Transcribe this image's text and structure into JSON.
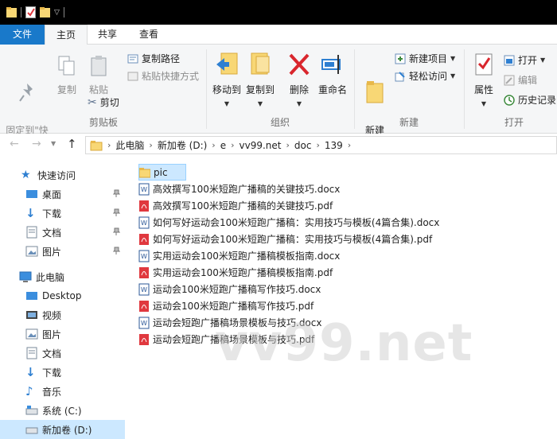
{
  "tabs": [
    {
      "label": "文件"
    },
    {
      "label": "主页"
    },
    {
      "label": "共享"
    },
    {
      "label": "查看"
    }
  ],
  "ribbon": {
    "clipboard": {
      "pin_label": "固定到\"快\n速访问\"",
      "copy_label": "复制",
      "paste_label": "粘贴",
      "copy_path_label": "复制路径",
      "paste_shortcut_label": "粘贴快捷方式",
      "cut_label": "剪切",
      "group_label": "剪贴板"
    },
    "organize": {
      "move_to_label": "移动到",
      "copy_to_label": "复制到",
      "delete_label": "删除",
      "rename_label": "重命名",
      "group_label": "组织"
    },
    "new": {
      "new_folder_label": "新建\n文件夹",
      "new_item_label": "新建项目",
      "easy_access_label": "轻松访问",
      "group_label": "新建"
    },
    "open": {
      "properties_label": "属性",
      "open_label": "打开",
      "edit_label": "编辑",
      "history_label": "历史记录",
      "group_label": "打开"
    }
  },
  "address": {
    "crumbs": [
      "此电脑",
      "新加卷 (D:)",
      "e",
      "vv99.net",
      "doc",
      "139"
    ]
  },
  "nav": {
    "quick_access": "快速访问",
    "quick_items": [
      {
        "label": "桌面"
      },
      {
        "label": "下载"
      },
      {
        "label": "文档"
      },
      {
        "label": "图片"
      }
    ],
    "this_pc": "此电脑",
    "pc_items": [
      {
        "label": "Desktop"
      },
      {
        "label": "视频"
      },
      {
        "label": "图片"
      },
      {
        "label": "文档"
      },
      {
        "label": "下载"
      },
      {
        "label": "音乐"
      },
      {
        "label": "系统 (C:)"
      },
      {
        "label": "新加卷 (D:)"
      }
    ]
  },
  "files": [
    {
      "name": "pic",
      "type": "folder"
    },
    {
      "name": "高效撰写100米短跑广播稿的关键技巧.docx",
      "type": "docx"
    },
    {
      "name": "高效撰写100米短跑广播稿的关键技巧.pdf",
      "type": "pdf"
    },
    {
      "name": "如何写好运动会100米短跑广播稿：实用技巧与模板(4篇合集).docx",
      "type": "docx"
    },
    {
      "name": "如何写好运动会100米短跑广播稿：实用技巧与模板(4篇合集).pdf",
      "type": "pdf"
    },
    {
      "name": "实用运动会100米短跑广播稿模板指南.docx",
      "type": "docx"
    },
    {
      "name": "实用运动会100米短跑广播稿模板指南.pdf",
      "type": "pdf"
    },
    {
      "name": "运动会100米短跑广播稿写作技巧.docx",
      "type": "docx"
    },
    {
      "name": "运动会100米短跑广播稿写作技巧.pdf",
      "type": "pdf"
    },
    {
      "name": "运动会短跑广播稿场景模板与技巧.docx",
      "type": "docx"
    },
    {
      "name": "运动会短跑广播稿场景模板与技巧.pdf",
      "type": "pdf"
    }
  ],
  "watermark": "vv99.net",
  "colors": {
    "accent": "#1979ca",
    "selection": "#cce8ff",
    "folder": "#f8d775",
    "pdf": "#e0383e",
    "word": "#2b5797"
  }
}
